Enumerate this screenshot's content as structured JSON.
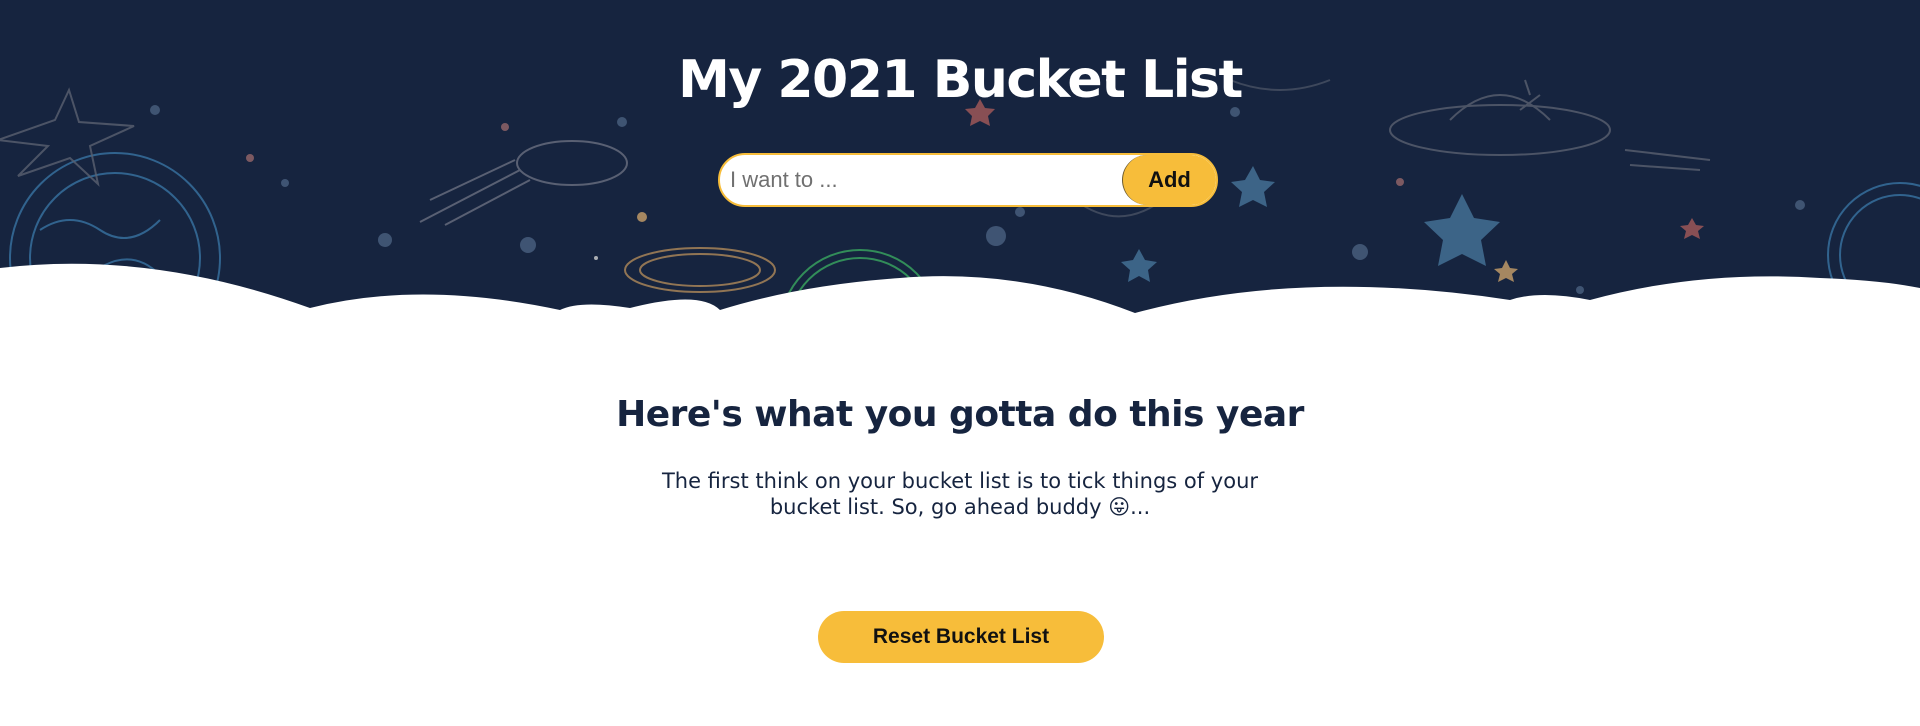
{
  "header": {
    "title": "My 2021 Bucket List"
  },
  "add_form": {
    "placeholder": "I want to ...",
    "value": "",
    "add_label": "Add"
  },
  "content": {
    "heading": "Here's what you gotta do this year",
    "text": "The first think on your bucket list is to tick things of your bucket list. So, go ahead buddy 😛...",
    "reset_label": "Reset Bucket List"
  },
  "colors": {
    "navy": "#16243f",
    "accent_yellow": "#f7bd3a",
    "white": "#ffffff"
  },
  "icons": {
    "hero_background": "space-doodles-illustration",
    "emoji": "tongue-out-emoji"
  }
}
